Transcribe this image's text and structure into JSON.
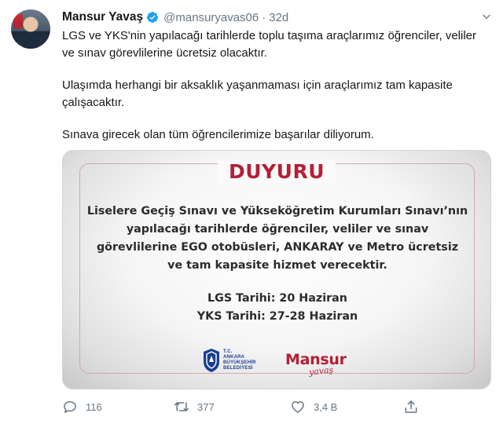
{
  "tweet": {
    "author": {
      "display_name": "Mansur Yavaş",
      "handle": "@mansuryavas06",
      "separator": "·",
      "time": "32d"
    },
    "paragraphs": [
      "LGS ve YKS'nin yapılacağı tarihlerde toplu taşıma araçlarımız öğrenciler, veliler ve sınav görevlilerine ücretsiz olacaktır.",
      "Ulaşımda herhangi bir aksaklık yaşanmaması için araçlarımız tam kapasite çalışacaktır.",
      "Sınava girecek olan tüm öğrencilerimize başarılar diliyorum."
    ],
    "image": {
      "heading": "DUYURU",
      "body_lines": [
        "Liselere Geçiş Sınavı ve Yükseköğretim Kurumları Sınavı’nın",
        "yapılacağı tarihlerde öğrenciler, veliler ve sınav",
        "görevlilerine EGO otobüsleri, ANKARAY ve Metro ücretsiz",
        "ve tam kapasite hizmet verecektir."
      ],
      "date_lines": [
        "LGS Tarihi: 20 Haziran",
        "YKS Tarihi: 27-28 Haziran"
      ],
      "logo_abb_lines": [
        "T.C.",
        "ANKARA",
        "BÜYÜKŞEHİR",
        "BELEDİYESİ"
      ],
      "logo_mansur_word": "Mansur",
      "logo_mansur_script": "yavaş"
    },
    "actions": {
      "reply_count": "116",
      "retweet_count": "377",
      "like_count": "3,4 B"
    },
    "icons": {
      "verified": "verified-badge-icon",
      "caret": "chevron-down-icon",
      "reply": "reply-icon",
      "retweet": "retweet-icon",
      "like": "heart-icon",
      "share": "share-icon"
    },
    "colors": {
      "verified": "#1da1f2",
      "muted": "#657786",
      "brand_red": "#b51f35",
      "abb_blue": "#1b3f8f"
    }
  }
}
